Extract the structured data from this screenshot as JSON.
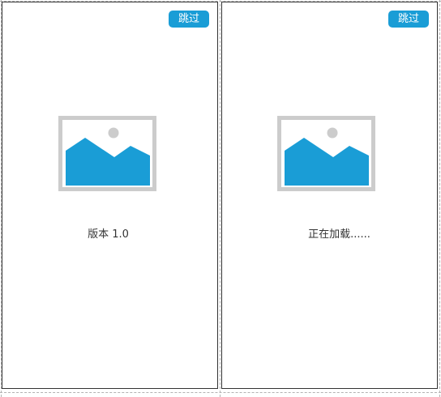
{
  "screens": [
    {
      "id": "version",
      "skip_label": "跳过",
      "caption": "版本 1.0",
      "image_icon": "image-placeholder-icon"
    },
    {
      "id": "loading",
      "skip_label": "跳过",
      "caption": "正在加载......",
      "image_icon": "image-placeholder-icon"
    }
  ],
  "colors": {
    "accent": "#1a9dd6",
    "frame": "#cccccc",
    "text": "#333333",
    "guide": "#b3b3b3"
  }
}
